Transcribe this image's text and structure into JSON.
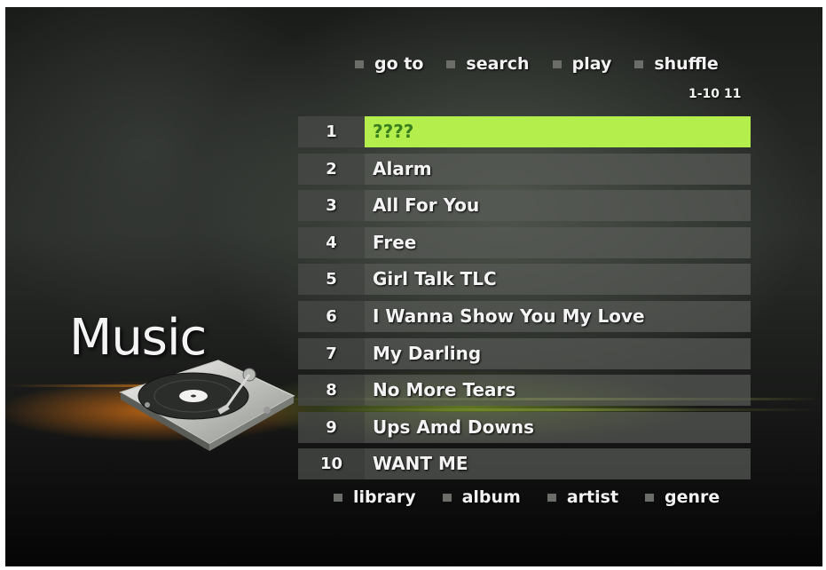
{
  "app": {
    "section_title": "Music"
  },
  "top_menu": [
    {
      "label": "go to"
    },
    {
      "label": "search"
    },
    {
      "label": "play"
    },
    {
      "label": "shuffle"
    }
  ],
  "page_indicator": "1-10 11",
  "tracks": [
    {
      "number": "1",
      "title": "????",
      "selected": true
    },
    {
      "number": "2",
      "title": "Alarm",
      "selected": false
    },
    {
      "number": "3",
      "title": "All For You",
      "selected": false
    },
    {
      "number": "4",
      "title": "Free",
      "selected": false
    },
    {
      "number": "5",
      "title": "Girl Talk TLC",
      "selected": false
    },
    {
      "number": "6",
      "title": "I Wanna Show You My Love",
      "selected": false
    },
    {
      "number": "7",
      "title": "My Darling",
      "selected": false
    },
    {
      "number": "8",
      "title": "No More Tears",
      "selected": false
    },
    {
      "number": "9",
      "title": "Ups Amd Downs",
      "selected": false
    },
    {
      "number": "10",
      "title": "WANT ME",
      "selected": false
    }
  ],
  "bottom_menu": [
    {
      "label": "library"
    },
    {
      "label": "album"
    },
    {
      "label": "artist"
    },
    {
      "label": "genre"
    }
  ],
  "colors": {
    "selection": "#b4ee4c",
    "selection_text": "#3a7f1e",
    "row": "#585a56",
    "accent_glow": "#e6781a"
  },
  "icons": {
    "menu_bullet": "square-bullet-icon",
    "turntable": "turntable-icon"
  }
}
